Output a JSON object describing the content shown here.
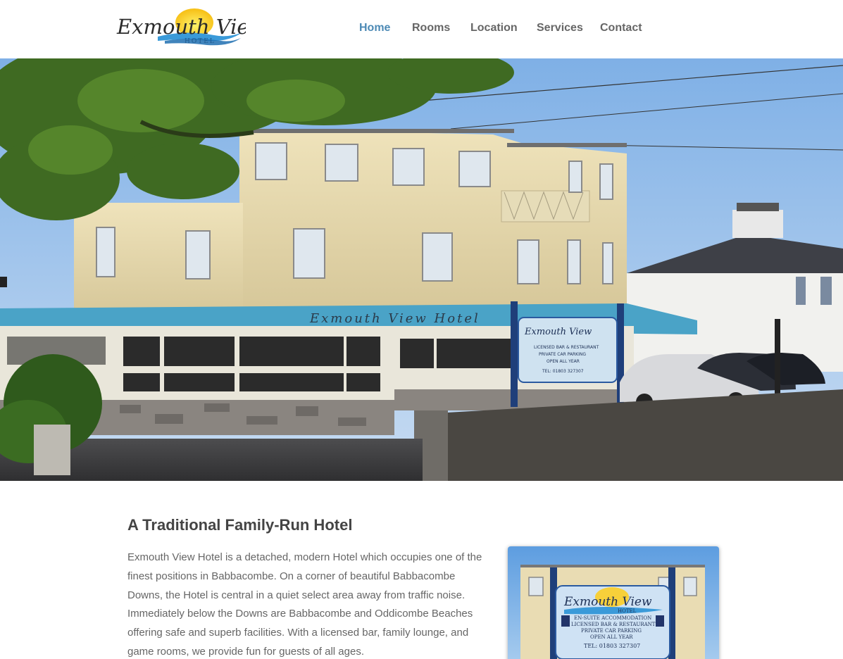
{
  "logo": {
    "name": "Exmouth View",
    "sub": "HOTEL"
  },
  "nav": {
    "items": [
      {
        "label": "Home",
        "active": true
      },
      {
        "label": "Rooms",
        "active": false
      },
      {
        "label": "Location",
        "active": false
      },
      {
        "label": "Services",
        "active": false
      },
      {
        "label": "Contact",
        "active": false
      }
    ]
  },
  "hero": {
    "sign_text": "Exmouth View Hotel",
    "board": {
      "name": "Exmouth View",
      "line1": "LICENSED BAR & RESTAURANT",
      "line2": "PRIVATE CAR PARKING",
      "line3": "OPEN ALL YEAR",
      "tel": "TEL: 01803 327307"
    }
  },
  "content": {
    "title": "A Traditional Family-Run Hotel",
    "paragraph": "Exmouth View Hotel is a detached, modern Hotel which occupies one of the finest positions in Babbacombe. On a corner of beautiful Babbacombe Downs, the Hotel is central in a quiet select area away from traffic noise. Immediately below the Downs are Babbacombe and Oddicombe Beaches offering safe and superb facilities. With a licensed bar, family lounge, and game rooms, we provide fun for guests of all ages."
  },
  "side_photo": {
    "name": "Exmouth View",
    "sub": "HOTEL",
    "line1": "EN-SUITE ACCOMMODATION",
    "line2": "LICENSED BAR & RESTAURANT",
    "line3": "PRIVATE CAR PARKING",
    "line4": "OPEN ALL YEAR",
    "tel": "TEL: 01803 327307"
  },
  "colors": {
    "nav_active": "#4d8ab5",
    "nav_default": "#666666",
    "heading": "#444444",
    "body_text": "#666666"
  }
}
